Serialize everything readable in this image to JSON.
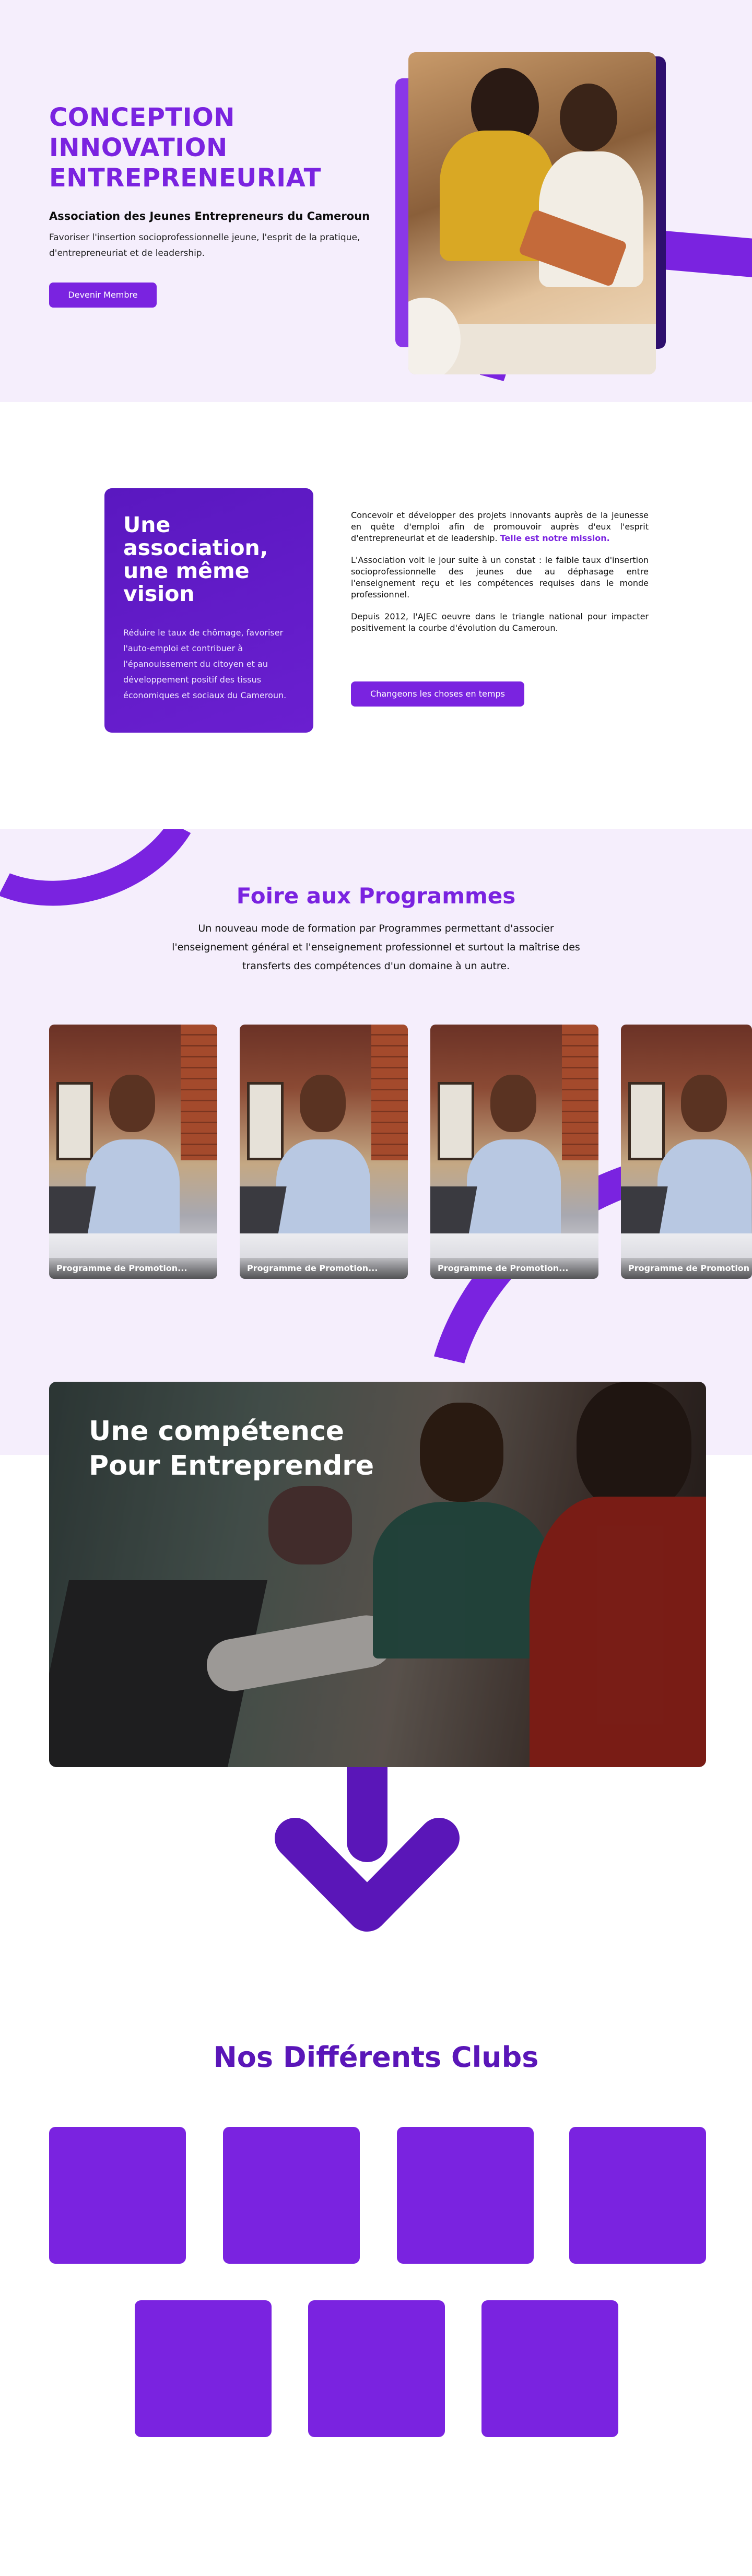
{
  "hero": {
    "title": "CONCEPTION\nINNOVATION\nENTREPRENEURIAT",
    "subtitle": "Association des Jeunes Entrepreneurs du Cameroun",
    "description": "Favoriser l'insertion socioprofessionnelle jeune, l'esprit de la pratique, d'entrepreneuriat et de leadership.",
    "button_label": "Devenir Membre"
  },
  "mission": {
    "card_title": "Une\nassociation,\nune même\nvision",
    "card_text": "Réduire le taux de chômage, favoriser l'auto-emploi et contribuer à l'épanouissement du citoyen et au développement positif des tissus économiques et sociaux du Cameroun.",
    "paragraph_1": "Concevoir et développer des projets innovants auprès de la jeunesse en quête d'emploi afin de promouvoir auprès d'eux l'esprit d'entrepreneuriat et de leadership.",
    "paragraph_1_accent": "Telle est notre mission.",
    "paragraph_2": "L'Association voit le jour suite à un constat : le faible taux d'insertion socioprofessionnelle des jeunes due au déphasage entre l'enseignement reçu et les compétences requises dans le monde professionnel.",
    "paragraph_3": "Depuis 2012, l'AJEC oeuvre dans le triangle national pour impacter positivement la courbe d'évolution du Cameroun.",
    "button_label": "Changeons les choses en temps"
  },
  "programmes": {
    "title": "Foire aux Programmes",
    "description": "Un nouveau mode de formation par Programmes permettant d'associer l'enseignement général et l'enseignement professionnel et surtout la maîtrise des transferts des compétences d'un domaine à un autre.",
    "cards": [
      {
        "label": "Programme de Promotion..."
      },
      {
        "label": "Programme de Promotion..."
      },
      {
        "label": "Programme de Promotion..."
      },
      {
        "label": "Programme de Promotion"
      }
    ]
  },
  "competence": {
    "title": "Une compétence\nPour Entreprendre"
  },
  "clubs": {
    "title": "Nos Différents Clubs",
    "count": 7
  },
  "colors": {
    "accent": "#7a23e0",
    "accent_dark": "#5a16b8",
    "background_light": "#f5eefc"
  }
}
